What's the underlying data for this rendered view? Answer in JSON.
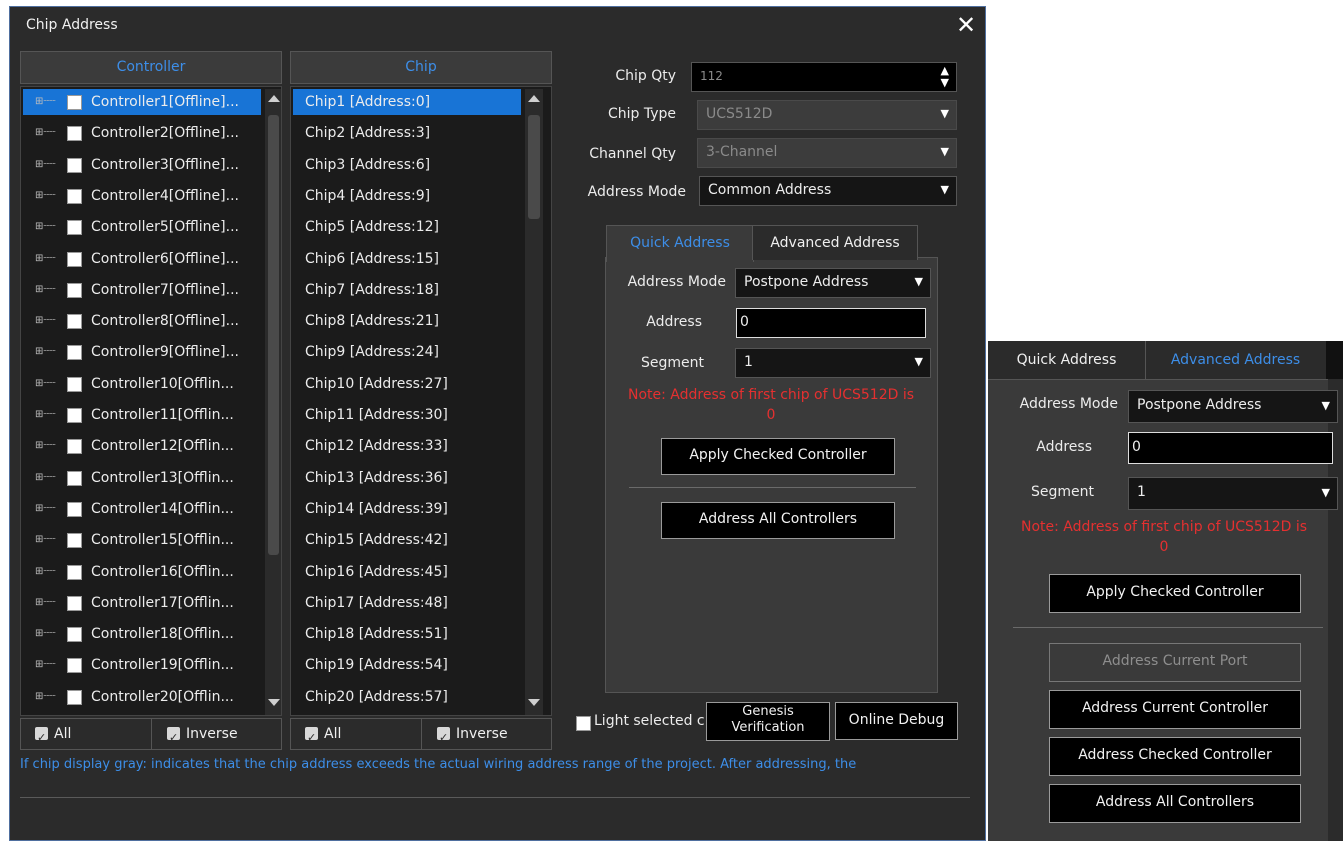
{
  "dialog": {
    "title": "Chip Address",
    "close_glyph": "✕"
  },
  "controller_panel": {
    "header": "Controller",
    "items": [
      "Controller1[Offline]...",
      "Controller2[Offline]...",
      "Controller3[Offline]...",
      "Controller4[Offline]...",
      "Controller5[Offline]...",
      "Controller6[Offline]...",
      "Controller7[Offline]...",
      "Controller8[Offline]...",
      "Controller9[Offline]...",
      "Controller10[Offlin...",
      "Controller11[Offlin...",
      "Controller12[Offlin...",
      "Controller13[Offlin...",
      "Controller14[Offlin...",
      "Controller15[Offlin...",
      "Controller16[Offlin...",
      "Controller17[Offlin...",
      "Controller18[Offlin...",
      "Controller19[Offlin...",
      "Controller20[Offlin..."
    ],
    "selected_index": 0,
    "all_label": "All",
    "inverse_label": "Inverse"
  },
  "chip_panel": {
    "header": "Chip",
    "items": [
      "Chip1 [Address:0]",
      "Chip2 [Address:3]",
      "Chip3 [Address:6]",
      "Chip4 [Address:9]",
      "Chip5 [Address:12]",
      "Chip6 [Address:15]",
      "Chip7 [Address:18]",
      "Chip8 [Address:21]",
      "Chip9 [Address:24]",
      "Chip10 [Address:27]",
      "Chip11 [Address:30]",
      "Chip12 [Address:33]",
      "Chip13 [Address:36]",
      "Chip14 [Address:39]",
      "Chip15 [Address:42]",
      "Chip16 [Address:45]",
      "Chip17 [Address:48]",
      "Chip18 [Address:51]",
      "Chip19 [Address:54]",
      "Chip20 [Address:57]"
    ],
    "selected_index": 0,
    "all_label": "All",
    "inverse_label": "Inverse"
  },
  "settings": {
    "chip_qty_label": "Chip Qty",
    "chip_qty_value": "112",
    "chip_type_label": "Chip Type",
    "chip_type_value": "UCS512D",
    "channel_qty_label": "Channel Qty",
    "channel_qty_value": "3-Channel",
    "address_mode_label": "Address Mode",
    "address_mode_value": "Common Address"
  },
  "quick_panel": {
    "tab_quick": "Quick Address",
    "tab_advanced": "Advanced Address",
    "address_mode_label": "Address Mode",
    "address_mode_value": "Postpone Address",
    "address_label": "Address",
    "address_value": "0",
    "segment_label": "Segment",
    "segment_value": "1",
    "note_line1": "Note: Address of first chip of UCS512D is",
    "note_line2": "0",
    "apply_checked": "Apply Checked Controller",
    "address_all": "Address All Controllers"
  },
  "bottom": {
    "light_selected": "Light selected c",
    "genesis_line1": "Genesis",
    "genesis_line2": "Verification",
    "online_debug": "Online Debug",
    "info_text": "If chip display gray: indicates that the chip address exceeds the actual wiring address range of the project. After addressing, the"
  },
  "advanced_panel": {
    "tab_quick": "Quick Address",
    "tab_advanced": "Advanced Address",
    "address_mode_label": "Address Mode",
    "address_mode_value": "Postpone Address",
    "address_label": "Address",
    "address_value": "0",
    "segment_label": "Segment",
    "segment_value": "1",
    "note_line1": "Note: Address of first chip of UCS512D is",
    "note_line2": "0",
    "apply_checked": "Apply Checked Controller",
    "address_current_port": "Address Current Port",
    "address_current_controller": "Address Current Controller",
    "address_checked_controller": "Address Checked Controller",
    "address_all": "Address All Controllers"
  },
  "colors": {
    "accent_blue": "#3d8ee8",
    "selection_blue": "#1874d6",
    "note_red": "#e53030",
    "dialog_bg": "#2b2b2b"
  }
}
